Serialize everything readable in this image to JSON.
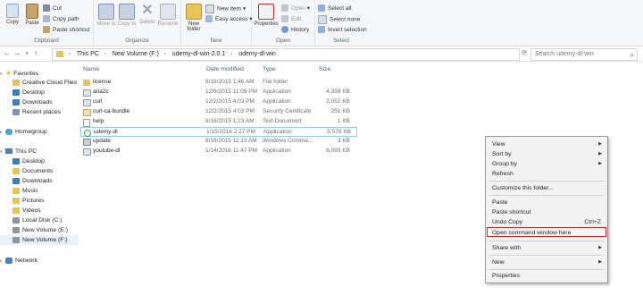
{
  "ribbon": {
    "clipboard": {
      "label": "Clipboard",
      "copy": "Copy",
      "paste": "Paste",
      "cut": "Cut",
      "copy_path": "Copy path",
      "paste_shortcut": "Paste shortcut"
    },
    "organize": {
      "label": "Organize",
      "move_to": "Move to",
      "copy_to": "Copy to",
      "delete": "Delete",
      "rename": "Rename"
    },
    "new": {
      "label": "New",
      "new_folder": "New folder",
      "new_item": "New item",
      "easy_access": "Easy access"
    },
    "open": {
      "label": "Open",
      "properties": "Properties",
      "open": "Open",
      "edit": "Edit",
      "history": "History"
    },
    "select": {
      "label": "Select",
      "select_all": "Select all",
      "select_none": "Select none",
      "invert_selection": "Invert selection"
    }
  },
  "address": {
    "crumbs": [
      "This PC",
      "New Volume (F:)",
      "udemy-dl-win-2.0.1",
      "udemy-dl-win"
    ],
    "search_placeholder": "Search udemy-dl-win"
  },
  "nav": {
    "favorites": "Favorites",
    "favorites_items": [
      "Creative Cloud Files",
      "Desktop",
      "Downloads",
      "Recent places"
    ],
    "homegroup": "Homegroup",
    "this_pc": "This PC",
    "pc_items": [
      "Desktop",
      "Documents",
      "Downloads",
      "Music",
      "Pictures",
      "Videos",
      "Local Disk (C:)",
      "New Volume (E:)",
      "New Volume (F:)"
    ],
    "network": "Network"
  },
  "columns": {
    "name": "Name",
    "date": "Date modified",
    "type": "Type",
    "size": "Size"
  },
  "files": [
    {
      "name": "license",
      "date": "8/16/2015 1:46 AM",
      "type": "File folder",
      "size": "",
      "icon": "folder-icon"
    },
    {
      "name": "aria2c",
      "date": "12/6/2015 11:09 PM",
      "type": "Application",
      "size": "4,358 KB",
      "icon": "app-icon"
    },
    {
      "name": "curl",
      "date": "12/2/2015 4:03 PM",
      "type": "Application",
      "size": "2,052 KB",
      "icon": "app-icon"
    },
    {
      "name": "curl-ca-bundle",
      "date": "12/2/2015 4:03 PM",
      "type": "Security Certificate",
      "size": "251 KB",
      "icon": "certificate-icon"
    },
    {
      "name": "help",
      "date": "8/16/2015 1:23 AM",
      "type": "Text Document",
      "size": "1 KB",
      "icon": "text-file-icon"
    },
    {
      "name": "udemy-dl",
      "date": "1/15/2016 2:27 PM",
      "type": "Application",
      "size": "5,578 KB",
      "icon": "udemy-app-icon"
    },
    {
      "name": "update",
      "date": "8/16/2015 11:13 AM",
      "type": "Windows Comma...",
      "size": "3 KB",
      "icon": "batch-file-icon"
    },
    {
      "name": "youtube-dl",
      "date": "1/14/2016 11:47 PM",
      "type": "Application",
      "size": "6,093 KB",
      "icon": "app-icon"
    }
  ],
  "context_menu": {
    "view": "View",
    "sort_by": "Sort by",
    "group_by": "Group by",
    "refresh": "Refresh",
    "customize": "Customize this folder...",
    "paste": "Paste",
    "paste_shortcut": "Paste shortcut",
    "undo_copy": "Undo Copy",
    "undo_shortcut": "Ctrl+Z",
    "open_cmd": "Open command window here",
    "share_with": "Share with",
    "new": "New",
    "properties": "Properties"
  },
  "colors": {
    "highlight_border": "#c42b2b",
    "folder": "#e8c35a",
    "selection": "#99c9ef"
  }
}
